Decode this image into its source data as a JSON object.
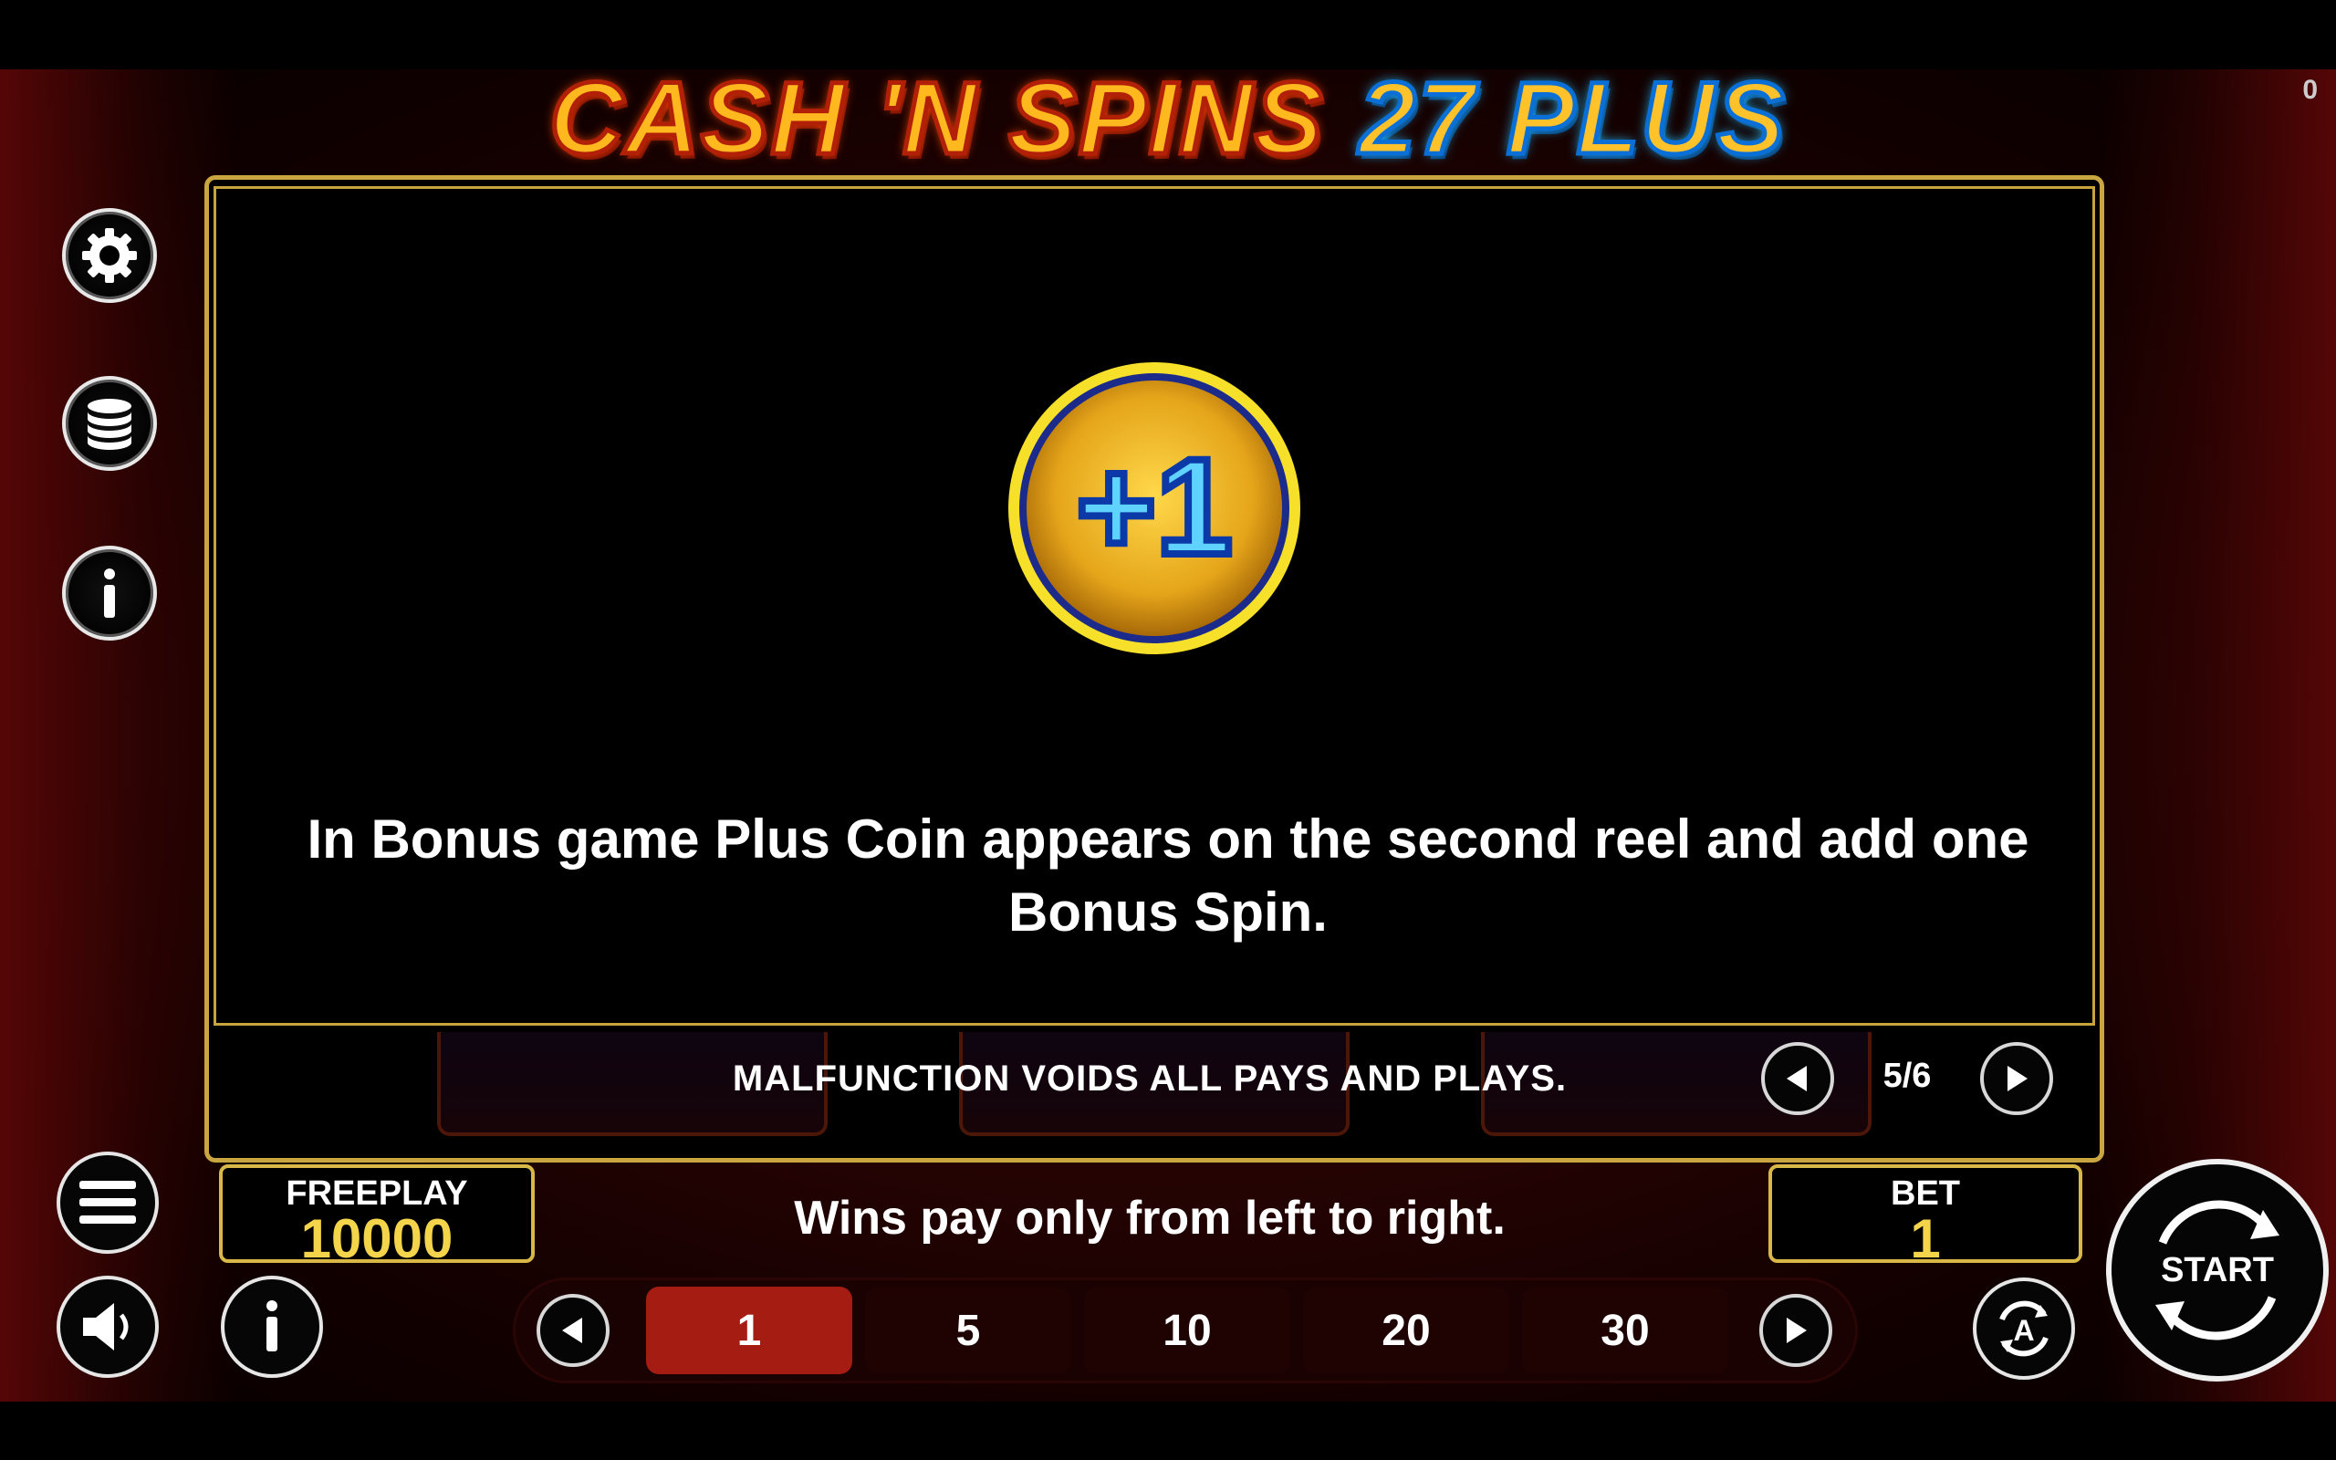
{
  "game": {
    "title_part1": "CASH 'N SPINS",
    "title_part2": "27 PLUS",
    "corner_counter": "0"
  },
  "info": {
    "description": "In Bonus game Plus Coin appears on the second reel and add one Bonus Spin.",
    "coin_label": "+1",
    "malfunction": "MALFUNCTION VOIDS ALL PAYS AND PLAYS.",
    "page_indicator": "5/6"
  },
  "footer": {
    "freeplay_label": "FREEPLAY",
    "freeplay_value": "10000",
    "bet_label": "BET",
    "bet_value": "1",
    "wins_text": "Wins pay only from left to right.",
    "start_label": "START",
    "bet_options": [
      "1",
      "5",
      "10",
      "20",
      "30"
    ],
    "selected_bet_index": 0
  },
  "icons": [
    "gear-icon",
    "coins-icon",
    "info-icon",
    "menu-icon",
    "sound-icon",
    "info-icon",
    "prev-arrow-icon",
    "next-arrow-icon",
    "autoplay-icon",
    "spin-arrows-icon"
  ],
  "colors": {
    "accent_gold": "#d9b848",
    "selected_bet": "#a51c12",
    "value_gold": "#f3d44a"
  }
}
